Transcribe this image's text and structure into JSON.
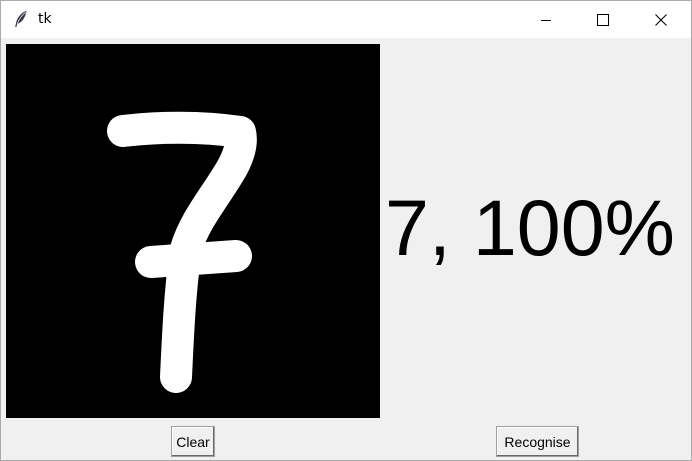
{
  "window": {
    "title": "tk",
    "icon": "feather-icon"
  },
  "controls": {
    "minimize_icon": "minimize-icon",
    "maximize_icon": "maximize-icon",
    "close_icon": "close-icon"
  },
  "canvas": {
    "background": "#000000",
    "stroke_color": "#ffffff",
    "drawn_digit": "7"
  },
  "result": {
    "text": "7, 100%"
  },
  "buttons": {
    "clear_label": "Clear",
    "recognise_label": "Recognise"
  }
}
